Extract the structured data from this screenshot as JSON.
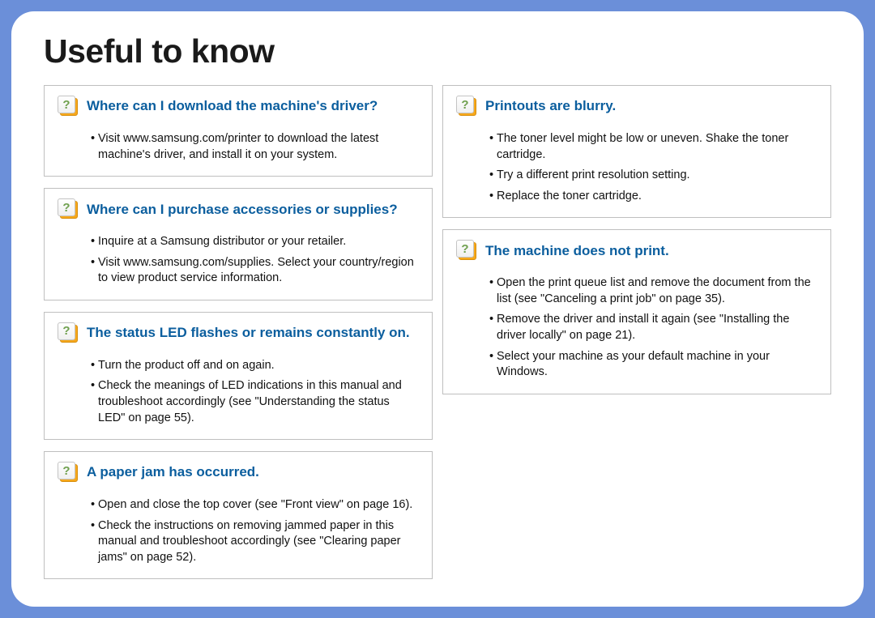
{
  "title": "Useful to know",
  "left": [
    {
      "q": "Where can I download the machine's driver?",
      "items": [
        "Visit www.samsung.com/printer to download the latest machine's driver, and install it on your system."
      ]
    },
    {
      "q": "Where can I purchase accessories or supplies?",
      "items": [
        "Inquire at a Samsung distributor or your retailer.",
        "Visit www.samsung.com/supplies. Select your country/region to view product service information."
      ]
    },
    {
      "q": "The status LED flashes or remains constantly on.",
      "items": [
        "Turn the product off and on again.",
        "Check the meanings of LED indications in this manual and troubleshoot accordingly (see \"Understanding the status LED\" on page 55)."
      ]
    },
    {
      "q": "A paper jam has occurred.",
      "items": [
        "Open and close the top cover (see \"Front view\" on page 16).",
        "Check the instructions on removing jammed paper in this manual and troubleshoot accordingly (see \"Clearing paper jams\" on page 52)."
      ]
    }
  ],
  "right": [
    {
      "q": "Printouts are blurry.",
      "items": [
        "The toner level might be low or uneven. Shake the toner cartridge.",
        "Try a different print resolution setting.",
        "Replace the toner cartridge."
      ]
    },
    {
      "q": "The machine does not print.",
      "items": [
        "Open the print queue list and remove the document from the list (see \"Canceling a print job\" on page 35).",
        "Remove the driver and install it again (see \"Installing the driver locally\" on page 21).",
        "Select your machine as your default machine in your Windows."
      ]
    }
  ]
}
